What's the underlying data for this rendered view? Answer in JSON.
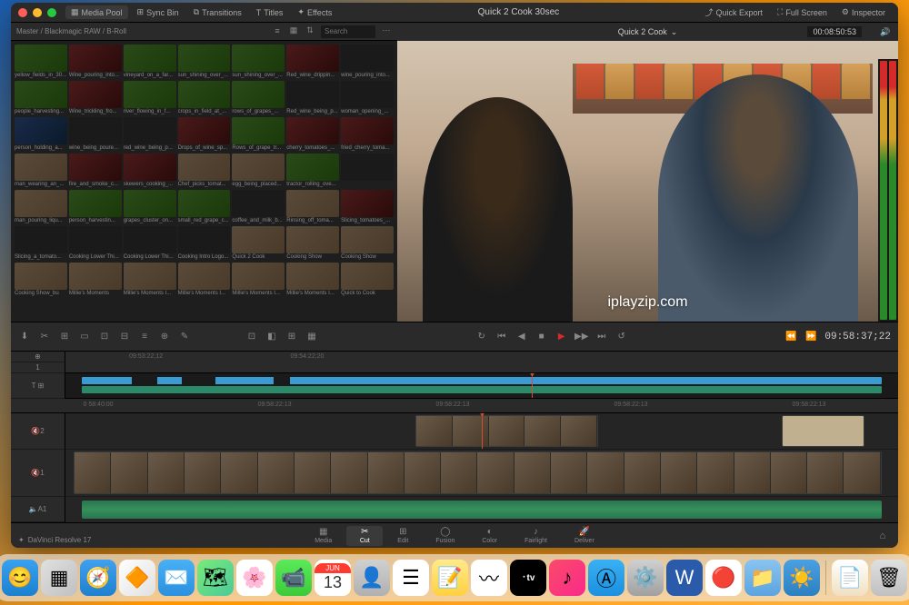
{
  "window": {
    "title": "Quick 2 Cook 30sec"
  },
  "titlebar_tabs": {
    "media_pool": "Media Pool",
    "sync_bin": "Sync Bin",
    "transitions": "Transitions",
    "titles": "Titles",
    "effects": "Effects"
  },
  "titlebar_right": {
    "quick_export": "Quick Export",
    "full_screen": "Full Screen",
    "inspector": "Inspector"
  },
  "media_pool": {
    "path": "Master / Blackmagic RAW / B-Roll",
    "search_placeholder": "Search",
    "items": [
      {
        "label": "yellow_fields_in_30...",
        "t": "green"
      },
      {
        "label": "Wine_pouring_into...",
        "t": "wine"
      },
      {
        "label": "vineyard_on_a_far...",
        "t": "green"
      },
      {
        "label": "sun_shining_over_...",
        "t": "green"
      },
      {
        "label": "sun_shining_over_...",
        "t": "green"
      },
      {
        "label": "Red_wine_drippin...",
        "t": "wine"
      },
      {
        "label": "wine_pouring_into...",
        "t": "dark"
      },
      {
        "label": "people_harvesting...",
        "t": "green"
      },
      {
        "label": "Wine_trickling_fro...",
        "t": "wine"
      },
      {
        "label": "river_flowing_in_f...",
        "t": "green"
      },
      {
        "label": "crops_in_field_at_...",
        "t": "green"
      },
      {
        "label": "rows_of_grapes_...",
        "t": "green"
      },
      {
        "label": "Red_wine_being_p...",
        "t": "dark"
      },
      {
        "label": "woman_opening_...",
        "t": "dark"
      },
      {
        "label": "person_holding_a...",
        "t": "blue"
      },
      {
        "label": "wine_being_poure...",
        "t": "dark"
      },
      {
        "label": "red_wine_being_p...",
        "t": "dark"
      },
      {
        "label": "Drops_of_wine_sp...",
        "t": "wine"
      },
      {
        "label": "Rows_of_grape_tr...",
        "t": "green"
      },
      {
        "label": "cherry_tomatoes_...",
        "t": "wine"
      },
      {
        "label": "fried_cherry_toma...",
        "t": "wine"
      },
      {
        "label": "man_wearing_an_...",
        "t": "kitchen"
      },
      {
        "label": "fire_and_smoke_c...",
        "t": "wine"
      },
      {
        "label": "skewers_cooking_...",
        "t": "wine"
      },
      {
        "label": "Chef_picks_tomat...",
        "t": "kitchen"
      },
      {
        "label": "egg_being_placed...",
        "t": "kitchen"
      },
      {
        "label": "tractor_rolling_ove...",
        "t": "green"
      },
      {
        "label": "",
        "t": "dark"
      },
      {
        "label": "man_pouring_liqu...",
        "t": "kitchen"
      },
      {
        "label": "person_harvestin...",
        "t": "green"
      },
      {
        "label": "grapes_cluster_on...",
        "t": "green"
      },
      {
        "label": "small_red_grape_c...",
        "t": "green"
      },
      {
        "label": "coffee_and_milk_b...",
        "t": "dark"
      },
      {
        "label": "Rinsing_off_toma...",
        "t": "kitchen"
      },
      {
        "label": "Slicing_tomatoes_...",
        "t": "wine"
      },
      {
        "label": "Slicing_a_tomato...",
        "t": "dark"
      },
      {
        "label": "Cooking Lower Thi...",
        "t": "dark"
      },
      {
        "label": "Cooking Lower Thi...",
        "t": "dark"
      },
      {
        "label": "Cooking Intro Logo...",
        "t": "dark"
      },
      {
        "label": "Quick 2 Cook",
        "t": "kitchen"
      },
      {
        "label": "Cooking Show",
        "t": "kitchen"
      },
      {
        "label": "Cooking Show",
        "t": "kitchen"
      },
      {
        "label": "Cooking Show_bu",
        "t": "kitchen"
      },
      {
        "label": "Millie's Moments",
        "t": "kitchen"
      },
      {
        "label": "Millie's Moments I...",
        "t": "kitchen"
      },
      {
        "label": "Millie's Moments I...",
        "t": "kitchen"
      },
      {
        "label": "Millie's Moments I...",
        "t": "kitchen"
      },
      {
        "label": "Millie's Moments I...",
        "t": "kitchen"
      },
      {
        "label": "Quick to Cook",
        "t": "kitchen"
      }
    ]
  },
  "viewer": {
    "title": "Quick 2 Cook",
    "timecode": "00:08:50:53",
    "watermark": "iplayzip.com"
  },
  "transport": {
    "timecode_right": "09:58:37;22",
    "ruler_times": [
      "09:53:22;12",
      "09:54:22;20",
      "",
      "",
      "",
      ""
    ],
    "ruler2_times": [
      "0 58:40:00",
      "09:58:22:13",
      "09:58:22:13",
      "09:58:22:13",
      "09:58:22:13"
    ]
  },
  "timeline": {
    "track_v1": "1",
    "track_v2": "2",
    "track_a1": "A1",
    "mute": "🔇",
    "solo": "🔈"
  },
  "bottom_tabs": {
    "media": "Media",
    "cut": "Cut",
    "edit": "Edit",
    "fusion": "Fusion",
    "color": "Color",
    "fairlight": "Fairlight",
    "deliver": "Deliver"
  },
  "app_name": "DaVinci Resolve 17",
  "dock": {
    "calendar_month": "JUN",
    "calendar_day": "13",
    "tv_label": "᛫tv"
  }
}
